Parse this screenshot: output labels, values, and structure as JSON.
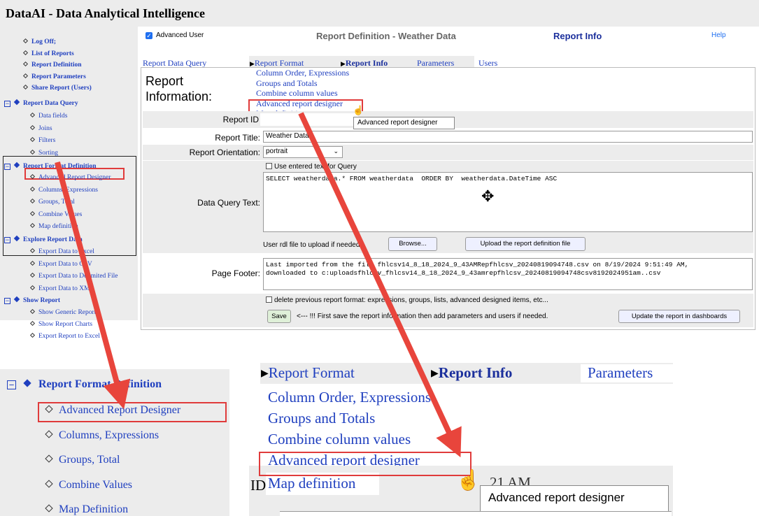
{
  "app": {
    "title": "DataAI - Data Analytical Intelligence"
  },
  "header": {
    "advanced_user_label": "Advanced User",
    "page_heading": "Report Definition - Weather Data",
    "section_heading": "Report Info",
    "help_link": "Help"
  },
  "sidebar": {
    "top_links": [
      "Log Off;",
      "List of Reports",
      "Report Definition",
      "Report Parameters",
      "Share Report (Users)"
    ],
    "groups": [
      {
        "title": "Report Data Query",
        "items": [
          "Data fields",
          "Joins",
          "Filters",
          "Sorting"
        ]
      },
      {
        "title": "Report Format Definition",
        "items": [
          "Advanced Report Designer",
          "Columns, Expressions",
          "Groups, Total",
          "Combine Values",
          "Map definition"
        ]
      },
      {
        "title": "Explore Report Data",
        "items": [
          "Export Data to Excel",
          "Export Data to CSV",
          "Export Data to Delimited File",
          "Export Data to XML"
        ]
      },
      {
        "title": "Show Report",
        "items": [
          "Show Generic Report",
          "Show Report Charts",
          "Export Report to Excel"
        ]
      }
    ]
  },
  "tabs": {
    "report_data_query": "Report Data Query",
    "report_format": "Report Format",
    "report_info": "Report Info",
    "parameters": "Parameters",
    "users": "Users"
  },
  "format_menu": {
    "items": [
      "Column Order, Expressions",
      "Groups and Totals",
      "Combine column values",
      "Advanced report designer",
      "Map definition"
    ],
    "tooltip": "Advanced report designer"
  },
  "form": {
    "section_title_1": "Report",
    "section_title_2": "Information:",
    "report_id_label": "Report ID",
    "report_title_label": "Report Title:",
    "report_title_value": "Weather Data",
    "orientation_label": "Report Orientation:",
    "orientation_value": "portrait",
    "use_entered_text_label": "Use entered text for Query",
    "data_query_label": "Data Query Text:",
    "data_query_value": "SELECT weatherdata.* FROM weatherdata  ORDER BY  weatherdata.DateTime ASC",
    "rdl_upload_label": "User rdl file to upload if needed:",
    "browse_button": "Browse...",
    "upload_button": "Upload the report definition file",
    "page_footer_label": "Page Footer:",
    "page_footer_value": "Last imported from the file fhlcsv14_8_18_2024_9_43AMRepfhlcsv_20240819094748.csv on 8/19/2024 9:51:49 AM,\ndownloaded to c:uploadsfhlcsv_fhlcsv14_8_18_2024_9_43amrepfhlcsv_20240819094748csv8192024951am..csv",
    "delete_previous_label": "delete previous report format: expressions, groups, lists, advanced designed items, etc...",
    "save_button": "Save",
    "save_note": "<--- !!! First save the report information then add parameters and users if needed.",
    "update_dashboards_button": "Update the report in dashboards"
  },
  "zoom_left": {
    "group_title": "Report Format Definition",
    "items": [
      "Advanced Report Designer",
      "Columns, Expressions",
      "Groups, Total",
      "Combine Values",
      "Map Definition"
    ]
  },
  "zoom_right": {
    "tab_report_format": "Report Format",
    "tab_report_info": "Report Info",
    "tab_parameters": "Parameters",
    "items": [
      "Column Order, Expressions",
      "Groups and Totals",
      "Combine column values",
      "Advanced report designer",
      "Map definition"
    ],
    "id_fragment": "ID",
    "time_fragment": "21 AM",
    "tooltip": "Advanced report designer"
  },
  "colors": {
    "link": "#1f3fbf",
    "highlight": "#e03b3b",
    "panel": "#ececec"
  }
}
